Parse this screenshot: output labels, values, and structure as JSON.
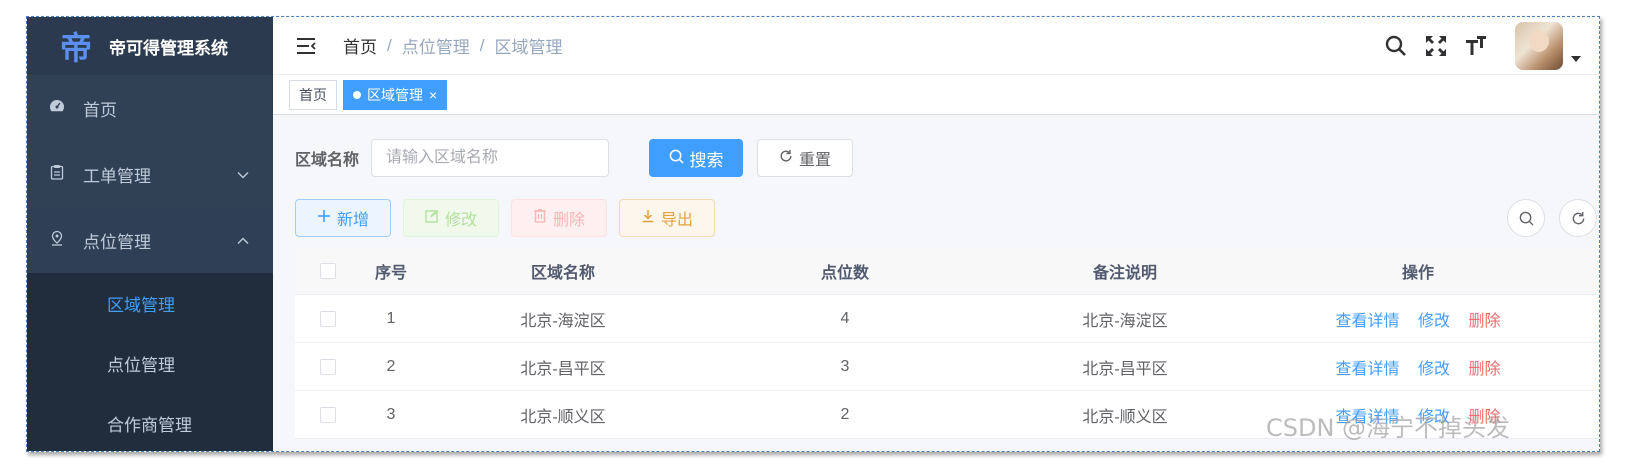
{
  "app": {
    "title": "帝可得管理系统",
    "logo_char": "帝"
  },
  "sidebar": {
    "items": [
      {
        "label": "首页"
      },
      {
        "label": "工单管理"
      },
      {
        "label": "点位管理"
      }
    ],
    "submenu": [
      {
        "label": "区域管理"
      },
      {
        "label": "点位管理"
      },
      {
        "label": "合作商管理"
      }
    ]
  },
  "breadcrumb": {
    "home": "首页",
    "parent": "点位管理",
    "current": "区域管理",
    "separator": "/"
  },
  "tags": {
    "home": "首页",
    "active": "区域管理",
    "close": "×"
  },
  "search": {
    "label": "区域名称",
    "placeholder": "请输入区域名称",
    "search_label": "搜索",
    "reset_label": "重置"
  },
  "toolbar": {
    "add": "新增",
    "edit": "修改",
    "delete": "删除",
    "export": "导出"
  },
  "table": {
    "headers": {
      "index": "序号",
      "name": "区域名称",
      "count": "点位数",
      "note": "备注说明",
      "ops": "操作"
    },
    "rows": [
      {
        "index": "1",
        "name": "北京-海淀区",
        "count": "4",
        "note": "北京-海淀区"
      },
      {
        "index": "2",
        "name": "北京-昌平区",
        "count": "3",
        "note": "北京-昌平区"
      },
      {
        "index": "3",
        "name": "北京-顺义区",
        "count": "2",
        "note": "北京-顺义区"
      }
    ],
    "ops": {
      "detail": "查看详情",
      "edit": "修改",
      "delete": "删除"
    }
  },
  "watermark": "CSDN @海宁不掉头发",
  "colors": {
    "sidebar_bg": "#304156",
    "primary": "#409eff",
    "danger": "#f56c6c",
    "warning": "#e6a23c",
    "success": "#67c23a"
  },
  "icons": [
    "logo-icon",
    "dashboard-icon",
    "clipboard-icon",
    "location-icon",
    "chevron-down-icon",
    "chevron-up-icon",
    "hamburger-icon",
    "search-icon",
    "fullscreen-icon",
    "font-size-icon",
    "avatar",
    "caret-down-icon",
    "plus-icon",
    "edit-icon",
    "trash-icon",
    "download-icon",
    "refresh-icon"
  ]
}
